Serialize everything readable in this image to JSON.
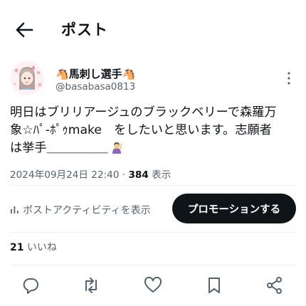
{
  "header": {
    "title": "ポスト"
  },
  "author": {
    "display_name": "🐴馬刺し選手🐴",
    "handle": "@basabasa0813"
  },
  "tweet": {
    "lines": [
      "明日はブリリアージュのブラックベリーで森羅万",
      "象☆ﾊﾟ-ﾎﾟｩmake　をしたいと思います。志願者",
      "は挙手＿＿＿＿＿"
    ],
    "timestamp": "2024年09月24日 22:40 · ",
    "views_count": "384",
    "views_label": " 表示"
  },
  "actions": {
    "activity_label": "ポストアクティビティを表示",
    "promote_label": "プロモーションする"
  },
  "stats": {
    "likes_count": "21",
    "likes_label": " いいね"
  },
  "icons": {
    "back": "arrow-left-icon",
    "more": "more-vertical-icon",
    "reply": "reply-icon",
    "repost": "repost-icon",
    "like": "heart-icon",
    "bookmark": "bookmark-icon",
    "share": "share-icon"
  },
  "colors": {
    "text": "#0f1419",
    "secondary": "#536471",
    "button": "#0f1419",
    "divider": "#eff3f4"
  }
}
